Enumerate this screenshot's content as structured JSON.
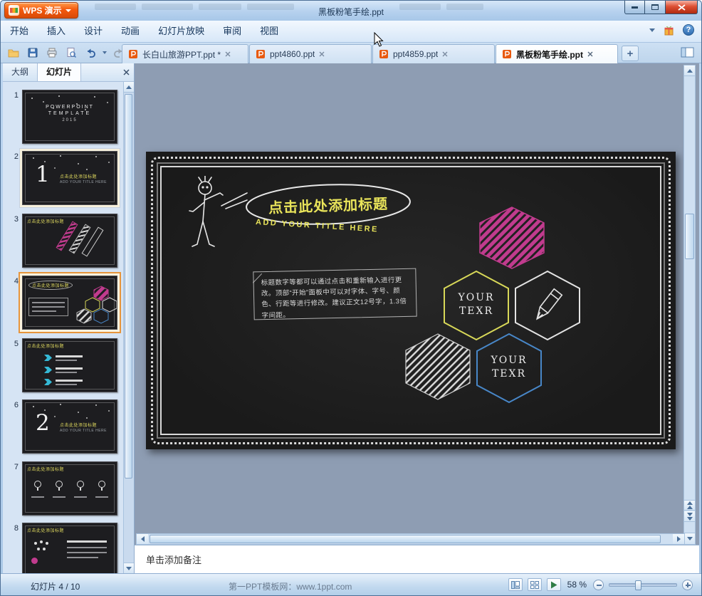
{
  "titlebar": {
    "app_button_label": "WPS 演示",
    "title": "黑板粉笔手绘.ppt"
  },
  "menubar": {
    "items": [
      {
        "label": "开始"
      },
      {
        "label": "插入"
      },
      {
        "label": "设计"
      },
      {
        "label": "动画"
      },
      {
        "label": "幻灯片放映"
      },
      {
        "label": "审阅"
      },
      {
        "label": "视图"
      }
    ],
    "help_mark": "?"
  },
  "doc_tabs": {
    "tabs": [
      {
        "label": "长白山旅游PPT.ppt *",
        "active": false
      },
      {
        "label": "ppt4860.ppt",
        "active": false
      },
      {
        "label": "ppt4859.ppt",
        "active": false
      },
      {
        "label": "黑板粉笔手绘.ppt",
        "active": true
      }
    ],
    "new_tab_label": "+"
  },
  "sidebar": {
    "outline_tab": "大纲",
    "slides_tab": "幻灯片",
    "thumbnails": [
      {
        "num": "1",
        "line1": "POWERPOINT",
        "line2": "TEMPLATE",
        "line3": "2015"
      },
      {
        "num": "2",
        "big": "1",
        "title": "点击此处添加标题",
        "sub": "ADD YOUR TITLE HERE"
      },
      {
        "num": "3"
      },
      {
        "num": "4"
      },
      {
        "num": "5"
      },
      {
        "num": "6",
        "big": "2",
        "title": "点击此处添加标题",
        "sub": "ADD YOUR TITLE HERE"
      },
      {
        "num": "7"
      },
      {
        "num": "8"
      }
    ]
  },
  "slide": {
    "title": "点击此处添加标题",
    "subtitle": "ADD YOUR TITLE HERE",
    "body": "标题数字等都可以通过点击和重新输入进行更改。顶部“开始”面板中可以对字体、字号、颜色、行距等进行修改。建议正文12号字，1.3倍字间距。",
    "hex_yellow_line1": "YOUR",
    "hex_yellow_line2": "TEXR",
    "hex_blue_line1": "YOUR",
    "hex_blue_line2": "TEXR",
    "colors": {
      "chalk": "#ececec",
      "yellow": "#e9e45a",
      "pink": "#c13b8e",
      "blue": "#4887c8"
    }
  },
  "notes": {
    "placeholder": "单击添加备注"
  },
  "statusbar": {
    "slide_counter": "幻灯片 4 / 10",
    "watermark": "第一PPT模板网：www.1ppt.com",
    "zoom_value": "58 %"
  }
}
